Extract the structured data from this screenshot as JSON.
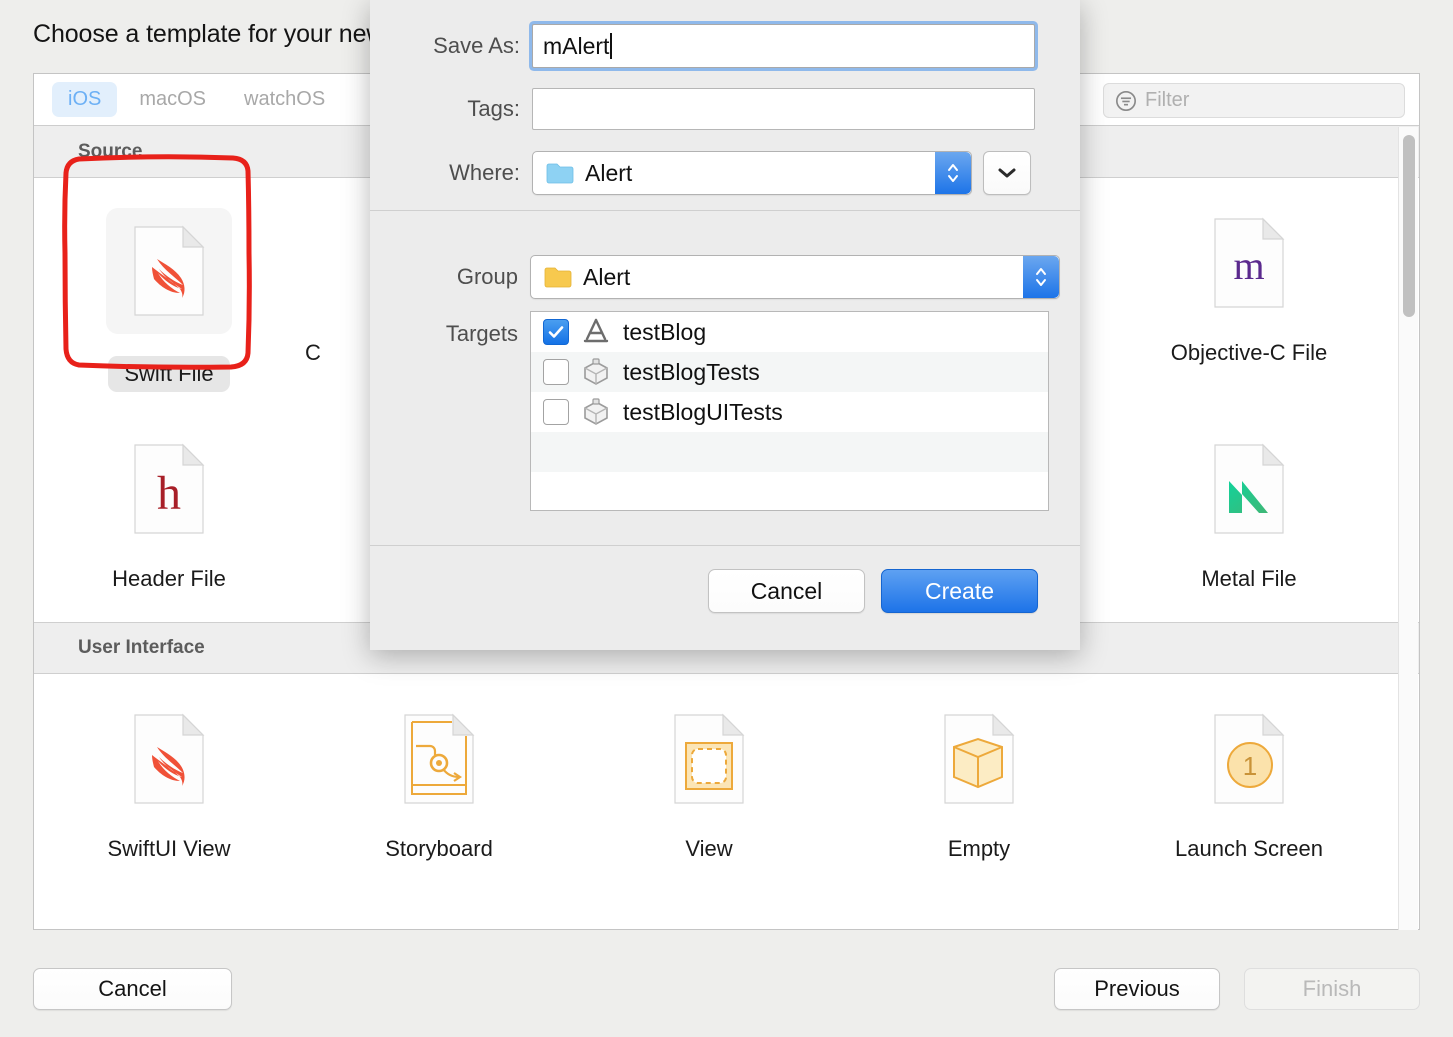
{
  "wizard": {
    "title": "Choose a template for your new file:",
    "tabs": [
      {
        "label": "iOS",
        "selected": true
      },
      {
        "label": "macOS",
        "selected": false
      },
      {
        "label": "watchOS",
        "selected": false
      }
    ],
    "filter": {
      "placeholder": "Filter",
      "value": "",
      "icon": "filter-icon"
    },
    "sections": [
      {
        "title": "Source",
        "items": [
          {
            "label": "Swift File",
            "icon": "swift-file-icon",
            "selected": true,
            "annotated": true
          },
          {
            "label": "C",
            "icon": "cocoa-touch-class-icon",
            "selected": false,
            "annotated": false
          },
          {
            "label": "Objective-C File",
            "icon": "objective-c-file-icon",
            "selected": false,
            "annotated": false
          },
          {
            "label": "Header File",
            "icon": "header-file-icon",
            "selected": false,
            "annotated": false
          },
          {
            "label": "Metal File",
            "icon": "metal-file-icon",
            "selected": false,
            "annotated": false
          }
        ]
      },
      {
        "title": "User Interface",
        "items": [
          {
            "label": "SwiftUI View",
            "icon": "swiftui-view-icon",
            "selected": false,
            "annotated": false
          },
          {
            "label": "Storyboard",
            "icon": "storyboard-icon",
            "selected": false,
            "annotated": false
          },
          {
            "label": "View",
            "icon": "view-icon",
            "selected": false,
            "annotated": false
          },
          {
            "label": "Empty",
            "icon": "empty-icon",
            "selected": false,
            "annotated": false
          },
          {
            "label": "Launch Screen",
            "icon": "launch-screen-icon",
            "selected": false,
            "annotated": false
          }
        ]
      }
    ],
    "buttons": {
      "cancel": "Cancel",
      "previous": "Previous",
      "finish": "Finish",
      "finish_disabled": true
    }
  },
  "sheet": {
    "save_as": {
      "label": "Save As:",
      "value": "mAlert",
      "focused": true
    },
    "tags": {
      "label": "Tags:",
      "value": "",
      "placeholder": ""
    },
    "where": {
      "label": "Where:",
      "value": "Alert",
      "icon": "blue-folder-icon"
    },
    "group": {
      "label": "Group",
      "value": "Alert",
      "icon": "yellow-folder-icon"
    },
    "targets": {
      "label": "Targets",
      "rows": [
        {
          "name": "testBlog",
          "checked": true,
          "icon": "app-target-icon"
        },
        {
          "name": "testBlogTests",
          "checked": false,
          "icon": "test-bundle-icon"
        },
        {
          "name": "testBlogUITests",
          "checked": false,
          "icon": "test-bundle-icon"
        }
      ]
    },
    "buttons": {
      "cancel": "Cancel",
      "create": "Create"
    }
  },
  "colors": {
    "accent_blue": "#1d73e8",
    "tab_selected_text": "#6cb0f5",
    "tab_selected_bg": "#e2effc",
    "annotation_red": "#e8211a",
    "swift_orange": "#f05138",
    "objc_purple": "#5b2a8e",
    "header_red": "#a81f28",
    "metal_green": "#21cf8d",
    "yellow": "#f0ad3c"
  }
}
